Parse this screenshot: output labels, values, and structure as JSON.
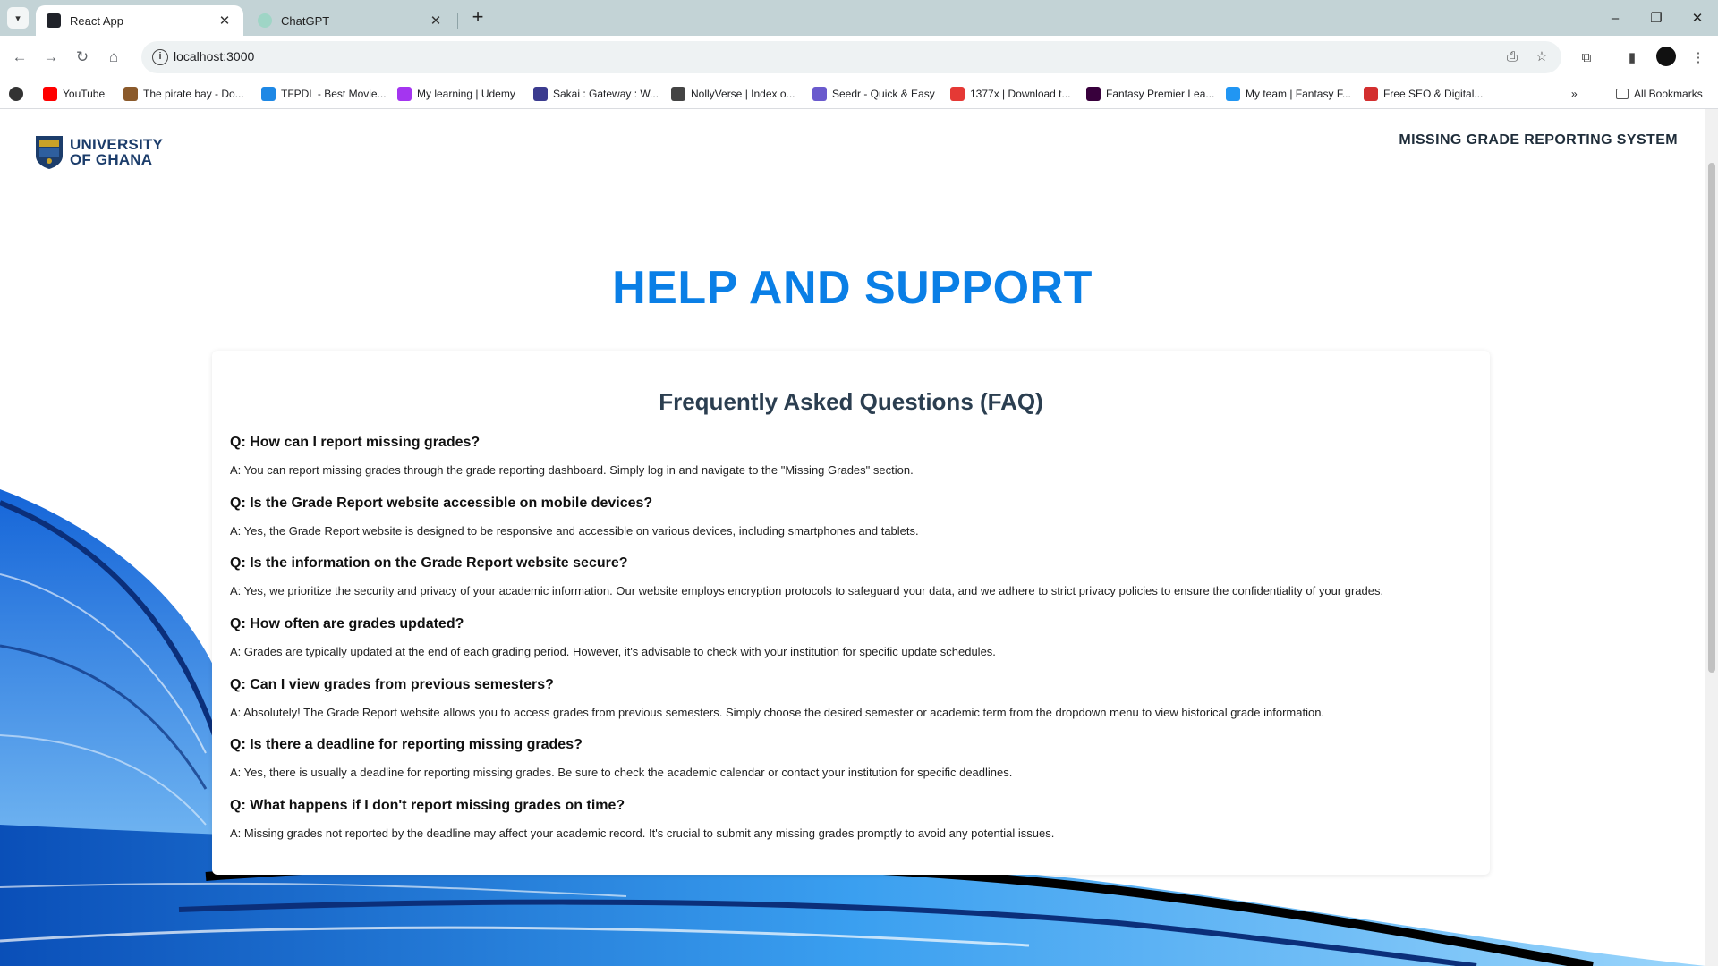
{
  "browser": {
    "tabs": [
      {
        "title": "React App",
        "active": true
      },
      {
        "title": "ChatGPT",
        "active": false
      }
    ],
    "url": "localhost:3000",
    "bookmarks": [
      {
        "label": "YouTube",
        "icon": "youtube-icon",
        "color": "#ff0000"
      },
      {
        "label": "The pirate bay - Do...",
        "icon": "pirate-ship-icon",
        "color": "#8b5a2b"
      },
      {
        "label": "TFPDL - Best Movie...",
        "icon": "tfpdl-icon",
        "color": "#1e88e5"
      },
      {
        "label": "My learning | Udemy",
        "icon": "udemy-icon",
        "color": "#a435f0"
      },
      {
        "label": "Sakai : Gateway : W...",
        "icon": "sakai-icon",
        "color": "#3b3b8f"
      },
      {
        "label": "NollyVerse | Index o...",
        "icon": "nollyverse-icon",
        "color": "#444444"
      },
      {
        "label": "Seedr - Quick & Easy",
        "icon": "seedr-icon",
        "color": "#6a5acd"
      },
      {
        "label": "1377x | Download t...",
        "icon": "x-icon",
        "color": "#e53935"
      },
      {
        "label": "Fantasy Premier Lea...",
        "icon": "premier-league-icon",
        "color": "#38003c"
      },
      {
        "label": "My team | Fantasy F...",
        "icon": "star-icon",
        "color": "#2196f3"
      },
      {
        "label": "Free SEO & Digital...",
        "icon": "pk-icon",
        "color": "#d32f2f"
      }
    ],
    "all_bookmarks": "All Bookmarks"
  },
  "header": {
    "logo_line1": "UNIVERSITY",
    "logo_line2": "OF GHANA",
    "system_title": "MISSING GRADE REPORTING SYSTEM"
  },
  "main": {
    "title": "HELP AND SUPPORT",
    "faq_title": "Frequently Asked Questions (FAQ)",
    "faqs": [
      {
        "q": "Q: How can I report missing grades?",
        "a": "A: You can report missing grades through the grade reporting dashboard. Simply log in and navigate to the \"Missing Grades\" section."
      },
      {
        "q": "Q: Is the Grade Report website accessible on mobile devices?",
        "a": "A: Yes, the Grade Report website is designed to be responsive and accessible on various devices, including smartphones and tablets."
      },
      {
        "q": "Q: Is the information on the Grade Report website secure?",
        "a": "A: Yes, we prioritize the security and privacy of your academic information. Our website employs encryption protocols to safeguard your data, and we adhere to strict privacy policies to ensure the confidentiality of your grades."
      },
      {
        "q": "Q: How often are grades updated?",
        "a": "A: Grades are typically updated at the end of each grading period. However, it's advisable to check with your institution for specific update schedules."
      },
      {
        "q": "Q: Can I view grades from previous semesters?",
        "a": "A: Absolutely! The Grade Report website allows you to access grades from previous semesters. Simply choose the desired semester or academic term from the dropdown menu to view historical grade information."
      },
      {
        "q": "Q: Is there a deadline for reporting missing grades?",
        "a": "A: Yes, there is usually a deadline for reporting missing grades. Be sure to check the academic calendar or contact your institution for specific deadlines."
      },
      {
        "q": "Q: What happens if I don't report missing grades on time?",
        "a": "A: Missing grades not reported by the deadline may affect your academic record. It's crucial to submit any missing grades promptly to avoid any potential issues."
      }
    ]
  },
  "colors": {
    "accent": "#0a7fe6",
    "logo": "#1c3d6b",
    "wave_dark": "#0a4fb8",
    "wave_light": "#7cc4f5"
  }
}
